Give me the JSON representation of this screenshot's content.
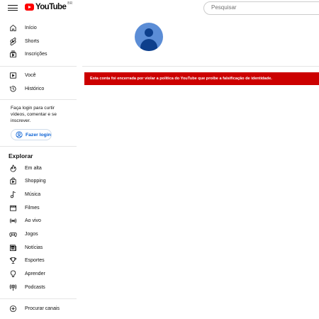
{
  "header": {
    "logo_text": "YouTube",
    "country_code": "BR",
    "search_placeholder": "Pesquisar"
  },
  "sidebar": {
    "main_items": [
      {
        "label": "Início",
        "icon": "home-icon"
      },
      {
        "label": "Shorts",
        "icon": "shorts-icon"
      },
      {
        "label": "Inscrições",
        "icon": "subscriptions-icon"
      }
    ],
    "you_items": [
      {
        "label": "Você",
        "icon": "you-icon"
      },
      {
        "label": "Histórico",
        "icon": "history-icon"
      }
    ],
    "login_prompt": "Faça login para curtir vídeos, comentar e se inscrever.",
    "login_button": "Fazer login",
    "explore_title": "Explorar",
    "explore_items": [
      {
        "label": "Em alta",
        "icon": "trending-icon"
      },
      {
        "label": "Shopping",
        "icon": "shopping-icon"
      },
      {
        "label": "Música",
        "icon": "music-icon"
      },
      {
        "label": "Filmes",
        "icon": "movies-icon"
      },
      {
        "label": "Ao vivo",
        "icon": "live-icon"
      },
      {
        "label": "Jogos",
        "icon": "gaming-icon"
      },
      {
        "label": "Notícias",
        "icon": "news-icon"
      },
      {
        "label": "Esportes",
        "icon": "sports-icon"
      },
      {
        "label": "Aprender",
        "icon": "learning-icon"
      },
      {
        "label": "Podcasts",
        "icon": "podcasts-icon"
      }
    ],
    "browse_channels": {
      "label": "Procurar canais",
      "icon": "add-circle-icon"
    }
  },
  "main": {
    "alert_text": "Esta conta foi encerrada por violar a política do YouTube que proíbe a falsificação de identidade."
  },
  "colors": {
    "brand_red": "#ff0000",
    "alert_red": "#cc0000",
    "link_blue": "#065fd4"
  }
}
